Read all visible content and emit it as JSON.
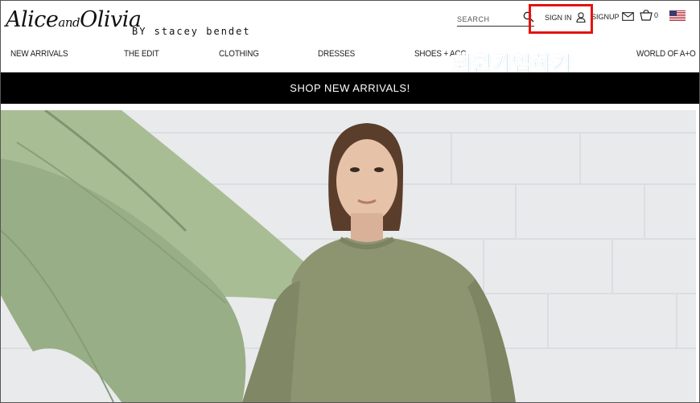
{
  "brand": {
    "logo_script": "Alice",
    "logo_and": "and",
    "logo_script2": "Olivia",
    "byline": "BY stacey bendet"
  },
  "header": {
    "search_placeholder": "SEARCH",
    "signin_label": "SIGN IN",
    "signup_label": "SIGNUP",
    "cart_count": "0",
    "search_icon": "search-icon",
    "user_icon": "user-icon",
    "mail_icon": "mail-icon",
    "cart_icon": "cart-icon",
    "flag_icon": "us-flag-icon",
    "highlight_color": "#e51212"
  },
  "nav": {
    "items": [
      "NEW ARRIVALS",
      "THE EDIT",
      "CLOTHING",
      "DRESSES",
      "SHOES + ACC",
      "WORLD OF A+O"
    ]
  },
  "annotation": {
    "text": "회원가입하기",
    "color": "#2ea8e6"
  },
  "banner": {
    "text": "SHOP NEW ARRIVALS!"
  }
}
